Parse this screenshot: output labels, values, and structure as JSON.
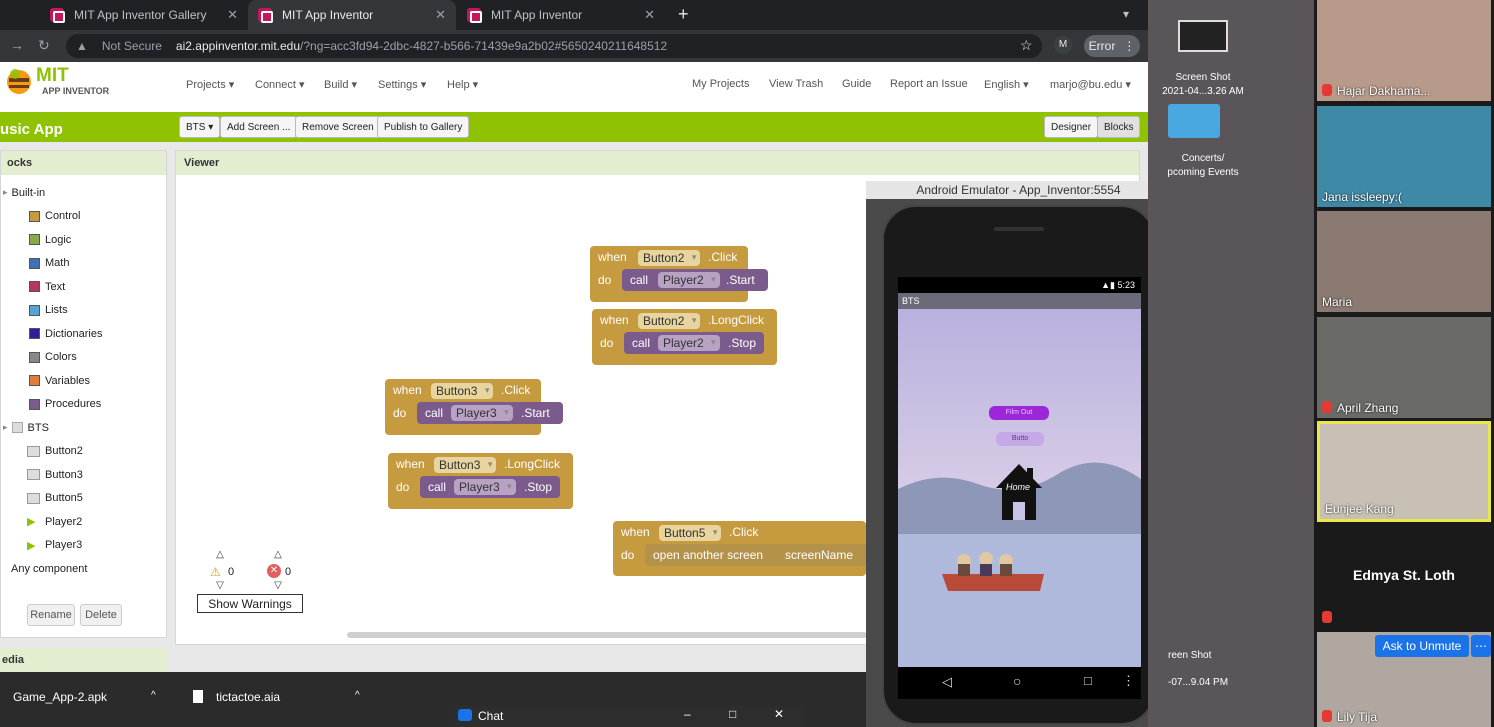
{
  "browser": {
    "tabs": [
      {
        "label": "MIT App Inventor Gallery"
      },
      {
        "label": "MIT App Inventor"
      },
      {
        "label": "MIT App Inventor"
      }
    ],
    "security_label": "Not Secure",
    "url_domain": "ai2.appinventor.mit.edu",
    "url_rest": "/?ng=acc3fd94-2dbc-4827-b566-71439e9a2b02#5650240211648512",
    "error_label": "Error",
    "profile_initial": "M"
  },
  "appinventor": {
    "logo_top": "MIT",
    "logo_bottom": "APP INVENTOR",
    "menus": [
      "Projects ▾",
      "Connect ▾",
      "Build ▾",
      "Settings ▾",
      "Help ▾"
    ],
    "right_links": [
      "My Projects",
      "View Trash",
      "Guide",
      "Report an Issue",
      "English ▾",
      "marjo@bu.edu ▾"
    ],
    "project_name": "usic App",
    "toolbar": {
      "screen_select": "BTS ▾",
      "add_screen": "Add Screen ...",
      "remove_screen": "Remove Screen",
      "publish": "Publish to Gallery",
      "designer": "Designer",
      "blocks": "Blocks"
    }
  },
  "blocks_panel": {
    "header": "ocks",
    "builtin_label": "Built-in",
    "builtin": [
      {
        "label": "Control",
        "color": "#c69a3f"
      },
      {
        "label": "Logic",
        "color": "#8aaa4a"
      },
      {
        "label": "Math",
        "color": "#3f6fb5"
      },
      {
        "label": "Text",
        "color": "#b4395f"
      },
      {
        "label": "Lists",
        "color": "#58a3d6"
      },
      {
        "label": "Dictionaries",
        "color": "#2d1f9a"
      },
      {
        "label": "Colors",
        "color": "#888888"
      },
      {
        "label": "Variables",
        "color": "#e07b39"
      },
      {
        "label": "Procedures",
        "color": "#7b5a8c"
      }
    ],
    "screen_label": "BTS",
    "components": [
      "Button2",
      "Button3",
      "Button5",
      "Player2",
      "Player3"
    ],
    "any_component": "Any component",
    "rename": "Rename",
    "delete": "Delete",
    "media_header": "edia"
  },
  "viewer": {
    "header": "Viewer",
    "blocks": [
      {
        "when": "when",
        "component": "Button2",
        "event": ".Click",
        "do": "do",
        "call": "call",
        "target": "Player2",
        "method": ".Start"
      },
      {
        "when": "when",
        "component": "Button2",
        "event": ".LongClick",
        "do": "do",
        "call": "call",
        "target": "Player2",
        "method": ".Stop"
      },
      {
        "when": "when",
        "component": "Button3",
        "event": ".Click",
        "do": "do",
        "call": "call",
        "target": "Player3",
        "method": ".Start"
      },
      {
        "when": "when",
        "component": "Button3",
        "event": ".LongClick",
        "do": "do",
        "call": "call",
        "target": "Player3",
        "method": ".Stop"
      },
      {
        "when": "when",
        "component": "Button5",
        "event": ".Click",
        "do": "do",
        "call": "open another screen",
        "target": "screenName",
        "method": ""
      }
    ],
    "warnings_count": "0",
    "errors_count": "0",
    "show_warnings": "Show Warnings"
  },
  "emulator": {
    "title": "Android Emulator - App_Inventor:5554",
    "status_time": "5:23",
    "app_title": "BTS",
    "film_out_btn": "Film Out",
    "button_label": "Butto",
    "home_label": "Home"
  },
  "desktop": {
    "file1": "Screen Shot",
    "file1b": "2021-04...3.26 AM",
    "folder": "Concerts/",
    "folder_b": "pcoming Events",
    "file2": "reen Shot",
    "file2b": "-07...9.04 PM"
  },
  "zoom": {
    "participants": [
      {
        "name": "Hajar Dakhama...",
        "muted": true
      },
      {
        "name": "Jana issleepy:(",
        "muted": false
      },
      {
        "name": "Maria",
        "muted": false
      },
      {
        "name": "April Zhang",
        "muted": true
      },
      {
        "name": "Eunjee Kang",
        "muted": false,
        "active": true
      },
      {
        "name": "Edmya St. Loth",
        "muted": true
      },
      {
        "name": "Lily Tija",
        "muted": true
      }
    ],
    "ask_unmute": "Ask to Unmute"
  },
  "taskbar": {
    "download1": "Game_App-2.apk",
    "download2": "tictactoe.aia"
  },
  "chat": {
    "label": "Chat"
  }
}
